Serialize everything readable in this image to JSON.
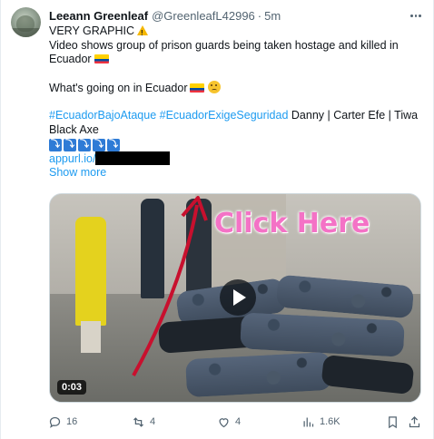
{
  "post": {
    "author_name": "Leeann Greenleaf",
    "author_handle": "@GreenleafL42996",
    "separator": "·",
    "time": "5m",
    "text": {
      "line1": "VERY GRAPHIC",
      "line2": "Video shows group of prison guards being taken hostage and killed in",
      "line3": "Ecuador",
      "line4": "What's going on in Ecuador",
      "hashtag1": "#EcuadorBajoAtaque",
      "hashtag2": "#EcuadorExigeSeguridad",
      "trend_text_a": " Danny | Carter Efe | Tiwa",
      "trend_text_b": "Black Axe",
      "arrows": [
        "⤵",
        "⤵",
        "⤵",
        "⤵",
        "⤵"
      ],
      "link_text": "appurl.io/",
      "show_more": "Show more"
    },
    "media": {
      "overlay_text": "Click Here",
      "duration": "0:03"
    },
    "actions": {
      "replies": "16",
      "reposts": "4",
      "likes": "4",
      "views": "1.6K"
    }
  },
  "colors": {
    "link": "#1d9bf0",
    "secondary_text": "#536471",
    "overlay_text": "#f472c6"
  },
  "icons": [
    "more-icon",
    "warning-icon",
    "ecuador-flag-icon",
    "confused-face-icon",
    "arrow-down-icon",
    "play-icon",
    "reply-icon",
    "repost-icon",
    "like-icon",
    "views-icon",
    "bookmark-icon",
    "share-icon"
  ]
}
